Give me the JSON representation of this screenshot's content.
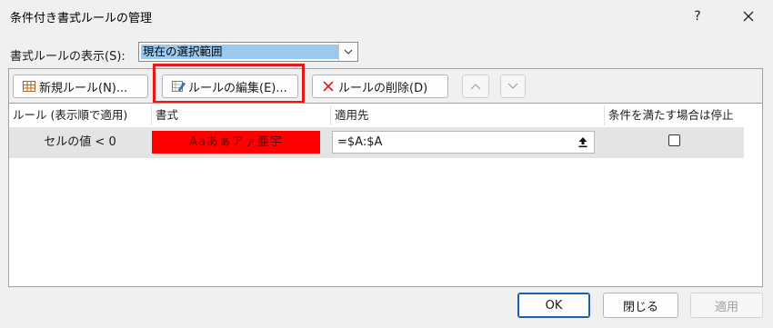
{
  "window": {
    "title": "条件付き書式ルールの管理",
    "help_label": "?",
    "close_label": "✕"
  },
  "scope": {
    "label": "書式ルールの表示(S):",
    "selected": "現在の選択範囲"
  },
  "toolbar": {
    "new_rule_label": "新規ルール(N)...",
    "edit_rule_label": "ルールの編集(E)...",
    "delete_rule_label": "ルールの削除(D)"
  },
  "grid": {
    "headers": [
      "ルール (表示順で適用)",
      "書式",
      "適用先",
      "条件を満たす場合は停止"
    ],
    "rows": [
      {
        "condition": "セルの値 < 0",
        "preview": "Aaあぁアァ亜宇",
        "applies_to": "=$A:$A",
        "stop_if_true": false
      }
    ]
  },
  "footer": {
    "ok_label": "OK",
    "close_label": "閉じる",
    "apply_label": "適用"
  },
  "colors": {
    "highlight": "#e21a1a",
    "preview_fill": "#ff0000",
    "selected_fill": "#99c9ef",
    "row_fill": "#e4e4e4"
  }
}
